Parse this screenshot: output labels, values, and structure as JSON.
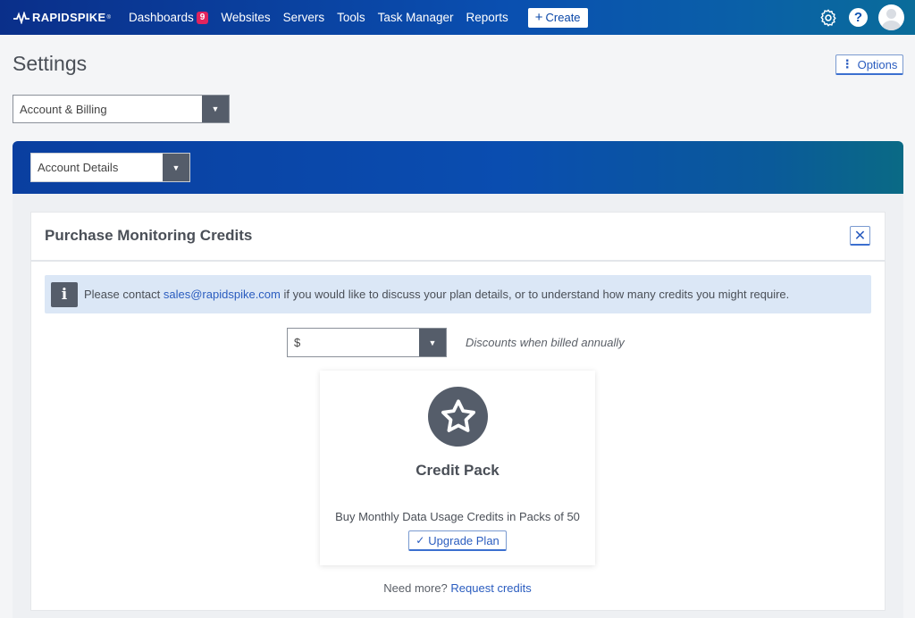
{
  "nav": {
    "logo_text": "RAPIDSPIKE",
    "logo_tm": "®",
    "items": [
      {
        "label": "Dashboards",
        "badge": "9"
      },
      {
        "label": "Websites"
      },
      {
        "label": "Servers"
      },
      {
        "label": "Tools"
      },
      {
        "label": "Task Manager"
      },
      {
        "label": "Reports"
      }
    ],
    "create_label": "Create",
    "help_label": "?"
  },
  "page": {
    "title": "Settings",
    "options_label": "Options",
    "section_select": "Account & Billing",
    "subsection_select": "Account Details"
  },
  "card": {
    "title": "Purchase Monitoring Credits",
    "close_label": "✕",
    "info": {
      "icon_label": "i",
      "text_before": "Please contact ",
      "email": "sales@rapidspike.com",
      "text_after": " if you would like to discuss your plan details, or to understand how many credits you might require."
    },
    "currency_select": "$",
    "discount_note": "Discounts when billed annually",
    "pack": {
      "title": "Credit Pack",
      "description": "Buy Monthly Data Usage Credits in Packs of 50",
      "button_label": "Upgrade Plan"
    },
    "need_more_text": "Need more? ",
    "need_more_link": "Request credits"
  },
  "colors": {
    "nav_gradient_start": "#0a2f8a",
    "nav_gradient_end": "#0a6c9a",
    "badge": "#e0245e",
    "link": "#2a5cbf",
    "icon_dark": "#555d6a"
  }
}
